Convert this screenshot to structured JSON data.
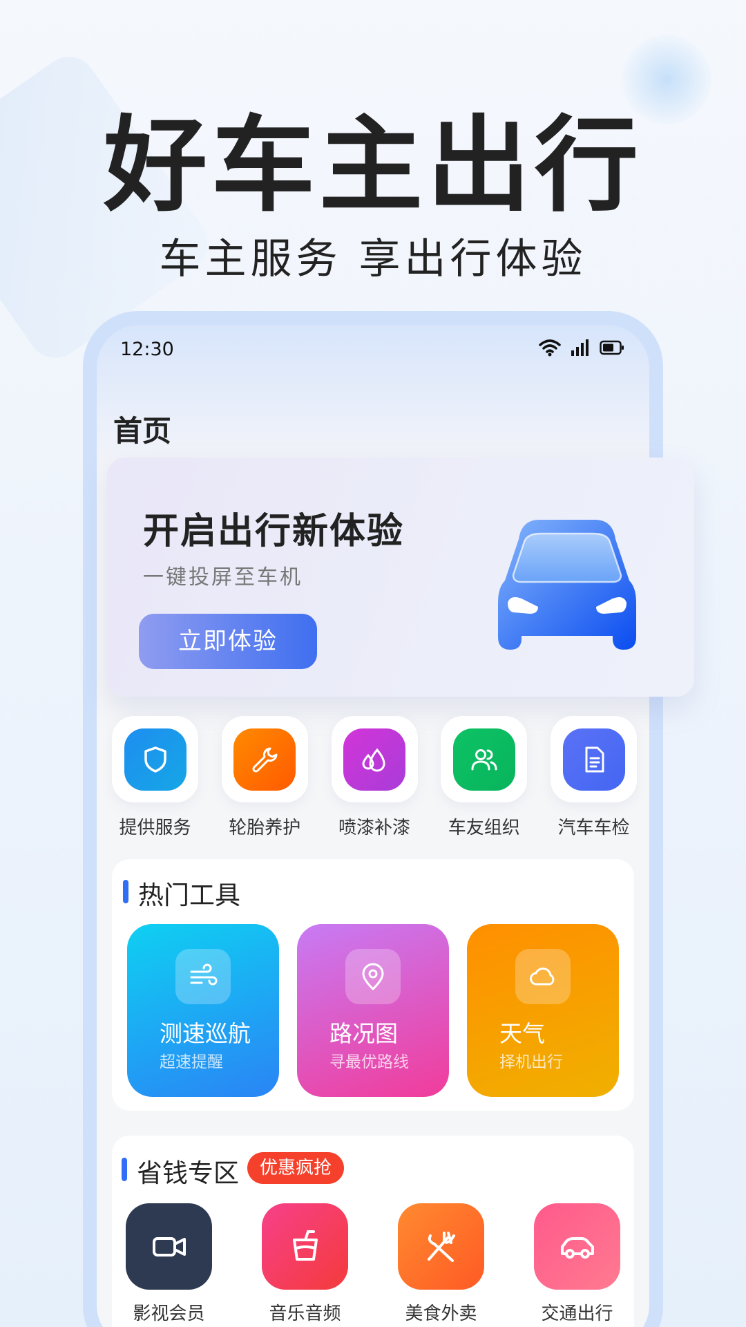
{
  "hero": {
    "title": "好车主出行",
    "subtitle": "车主服务 享出行体验"
  },
  "status_bar": {
    "time": "12:30",
    "icons": [
      "wifi-icon",
      "signal-icon",
      "battery-icon"
    ]
  },
  "page": {
    "title": "首页"
  },
  "banner": {
    "title": "开启出行新体验",
    "subtitle": "一键投屏至车机",
    "button": "立即体验"
  },
  "services": [
    {
      "label": "提供服务",
      "icon": "shield-icon",
      "color": "#1e8ef0"
    },
    {
      "label": "轮胎养护",
      "icon": "wrench-icon",
      "color": "#ff6d00"
    },
    {
      "label": "喷漆补漆",
      "icon": "paint-drops-icon",
      "color": "#c936d6"
    },
    {
      "label": "车友组织",
      "icon": "users-icon",
      "color": "#0ec265"
    },
    {
      "label": "汽车车检",
      "icon": "document-icon",
      "color": "#4d6cf5"
    }
  ],
  "hot_tools": {
    "title": "热门工具",
    "items": [
      {
        "title": "测速巡航",
        "subtitle": "超速提醒",
        "icon": "wind-icon"
      },
      {
        "title": "路况图",
        "subtitle": "寻最优路线",
        "icon": "location-pin-icon"
      },
      {
        "title": "天气",
        "subtitle": "择机出行",
        "icon": "cloud-icon"
      }
    ]
  },
  "savings": {
    "title": "省钱专区",
    "badge": "优惠疯抢",
    "items": [
      {
        "label": "影视会员",
        "icon": "video-camera-icon",
        "color": "#2e3a52"
      },
      {
        "label": "音乐音频",
        "icon": "drink-cup-icon",
        "color": "#f43b6e"
      },
      {
        "label": "美食外卖",
        "icon": "fork-knife-icon",
        "color": "#ff6a2a"
      },
      {
        "label": "交通出行",
        "icon": "car-icon",
        "color": "#ff6a8c"
      }
    ]
  }
}
